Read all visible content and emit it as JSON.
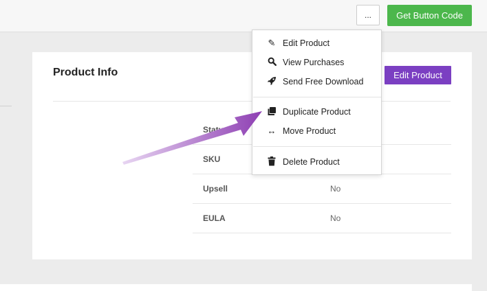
{
  "topbar": {
    "more_label": "...",
    "get_code_label": "Get Button Code"
  },
  "card": {
    "title": "Product Info",
    "edit_label": "Edit Product",
    "rows": [
      {
        "key": "Status",
        "value": ""
      },
      {
        "key": "SKU",
        "value": ""
      },
      {
        "key": "Upsell",
        "value": "No"
      },
      {
        "key": "EULA",
        "value": "No"
      }
    ]
  },
  "menu": {
    "items": [
      {
        "label": "Edit Product",
        "icon": "pencil-icon"
      },
      {
        "label": "View Purchases",
        "icon": "search-icon"
      },
      {
        "label": "Send Free Download",
        "icon": "rocket-icon"
      },
      {
        "label": "Duplicate Product",
        "icon": "copy-icon"
      },
      {
        "label": "Move Product",
        "icon": "move-arrows-icon"
      },
      {
        "label": "Delete Product",
        "icon": "trash-icon"
      }
    ]
  },
  "colors": {
    "green": "#4cb74c",
    "purple": "#7b3fc2",
    "arrow": "#8e3fb3"
  }
}
